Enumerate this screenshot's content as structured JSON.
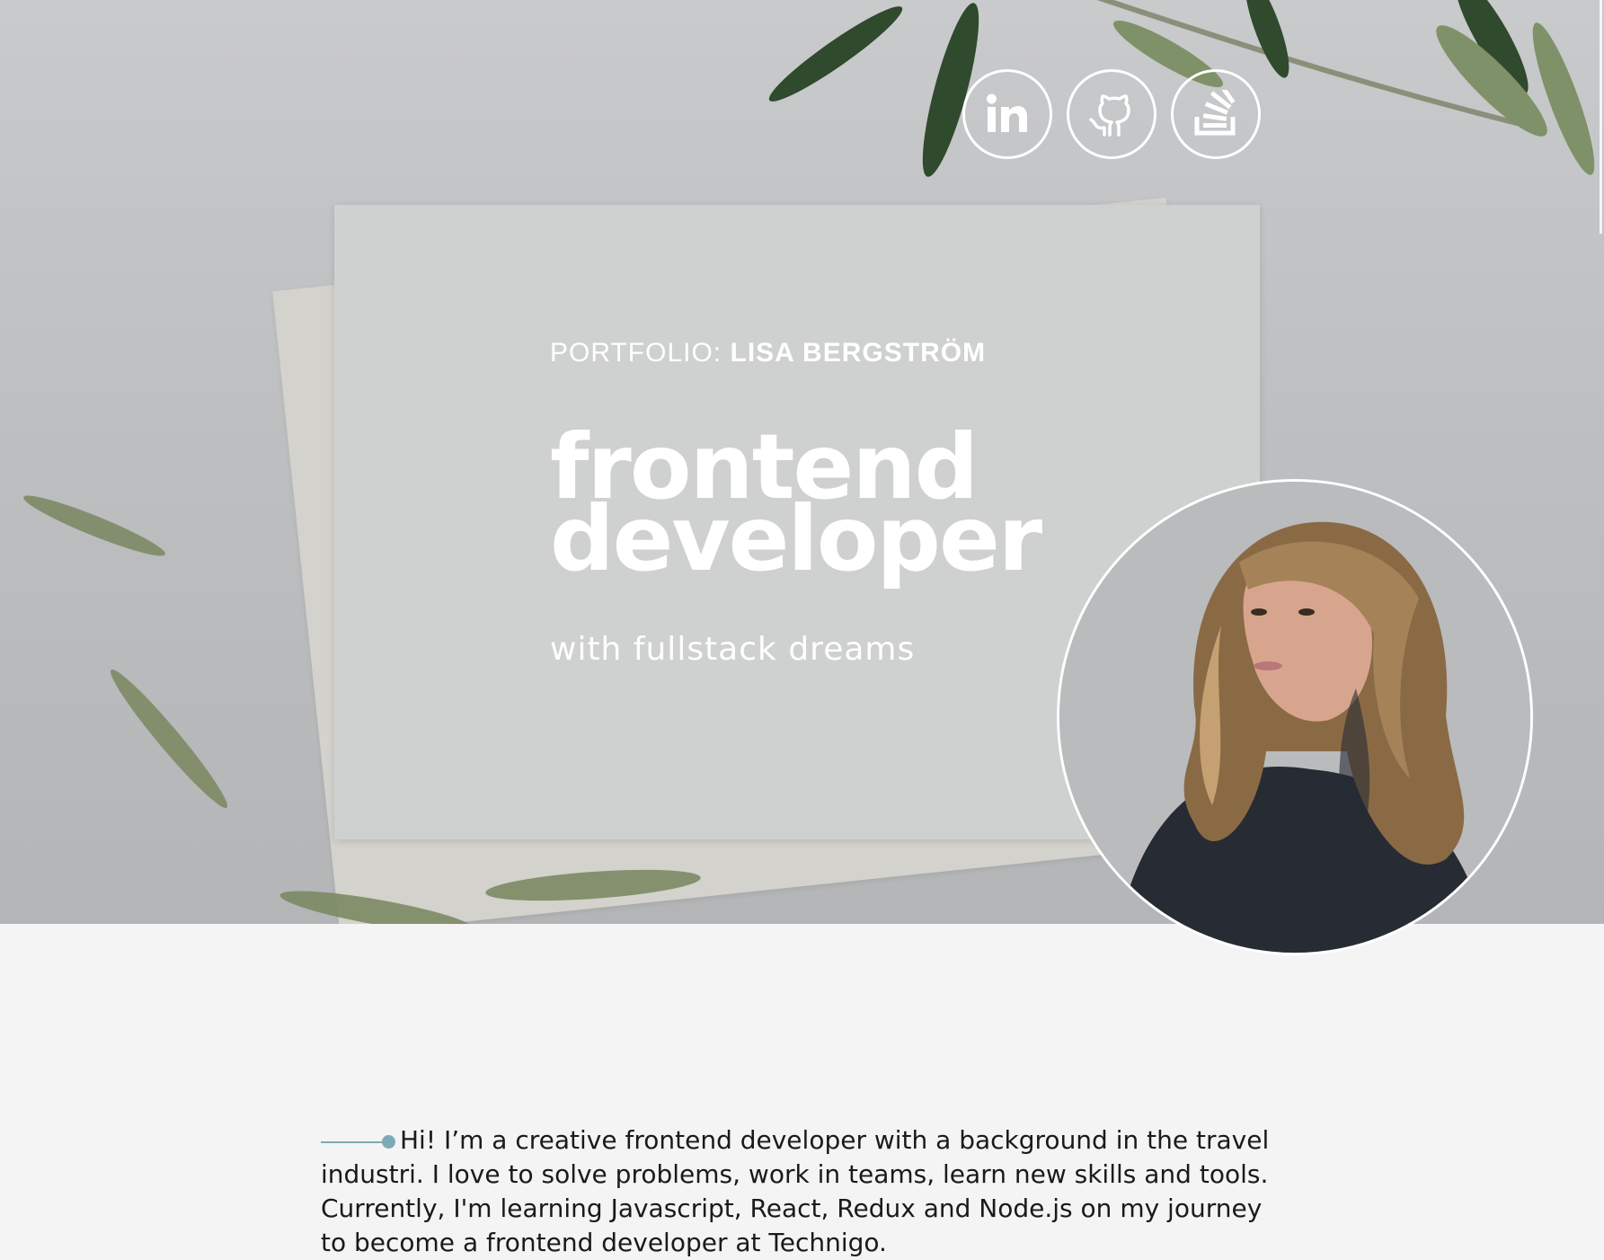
{
  "hero": {
    "portfolio_prefix": "PORTFOLIO:",
    "portfolio_name": "LISA BERGSTRÖM",
    "headline_line1": "frontend",
    "headline_line2": "developer",
    "tagline": "with fullstack dreams"
  },
  "socials": [
    {
      "label": "LinkedIn",
      "icon": "linkedin-icon"
    },
    {
      "label": "GitHub",
      "icon": "github-icon"
    },
    {
      "label": "Stack Overflow",
      "icon": "stackoverflow-icon"
    }
  ],
  "intro": {
    "text": "Hi! I’m a creative frontend developer with a background in the travel industri. I love to solve problems, work in teams, learn new skills and tools. Currently, I'm learning Javascript, React, Redux and Node.js on my journey to become a frontend developer at Technigo."
  },
  "colors": {
    "accent": "#7fa9b6",
    "text": "#1a1a1a",
    "background": "#f4f4f4",
    "white": "#ffffff"
  }
}
